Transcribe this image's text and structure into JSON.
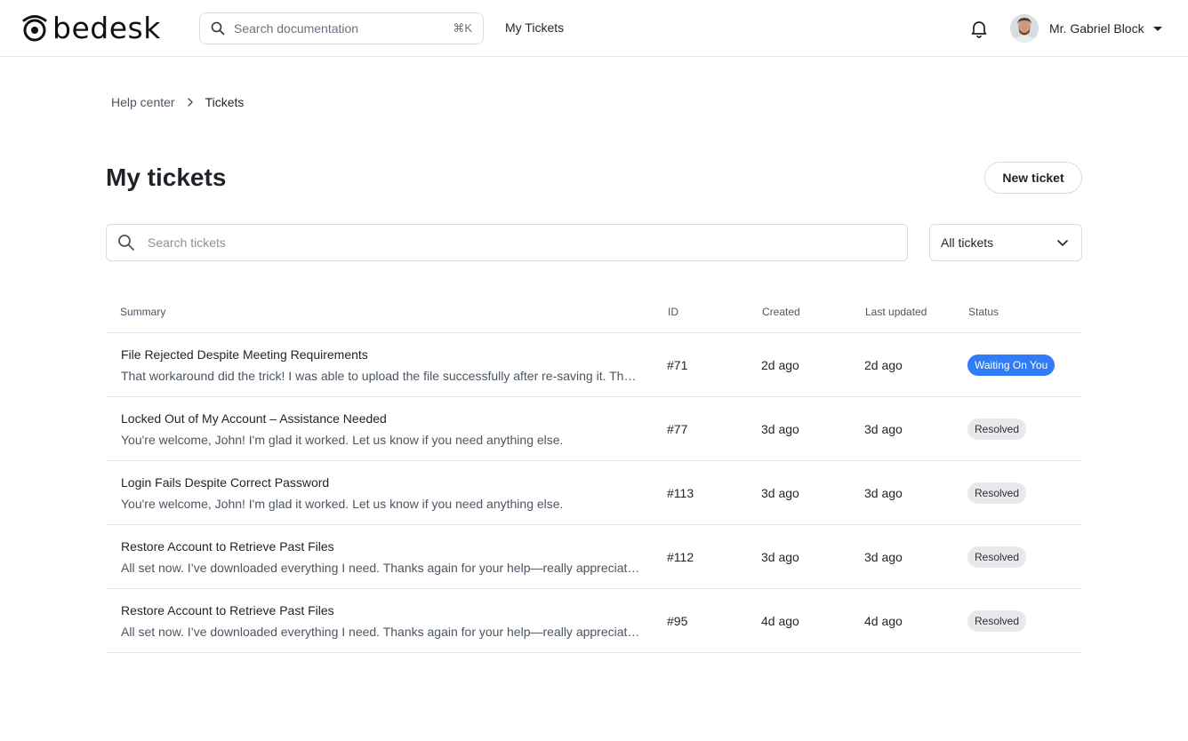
{
  "header": {
    "logo_text": "bedesk",
    "search_placeholder": "Search documentation",
    "search_shortcut": "⌘K",
    "nav_link": "My Tickets",
    "user_name": "Mr. Gabriel Block"
  },
  "breadcrumb": {
    "home": "Help center",
    "current": "Tickets"
  },
  "page": {
    "title": "My tickets",
    "new_ticket_label": "New ticket",
    "search_placeholder": "Search tickets",
    "filter_value": "All tickets"
  },
  "table": {
    "columns": {
      "summary": "Summary",
      "id": "ID",
      "created": "Created",
      "updated": "Last updated",
      "status": "Status"
    },
    "rows": [
      {
        "title": "File Rejected Despite Meeting Requirements",
        "body": "That workaround did the trick! I was able to upload the file successfully after re-saving it. Thanks again!",
        "id": "#71",
        "created": "2d ago",
        "updated": "2d ago",
        "status": "Waiting On You"
      },
      {
        "title": "Locked Out of My Account – Assistance Needed",
        "body": "You're welcome, John! I'm glad it worked. Let us know if you need anything else.",
        "id": "#77",
        "created": "3d ago",
        "updated": "3d ago",
        "status": "Resolved"
      },
      {
        "title": "Login Fails Despite Correct Password",
        "body": "You're welcome, John! I'm glad it worked. Let us know if you need anything else.",
        "id": "#113",
        "created": "3d ago",
        "updated": "3d ago",
        "status": "Resolved"
      },
      {
        "title": "Restore Account to Retrieve Past Files",
        "body": "All set now. I’ve downloaded everything I need. Thanks again for your help—really appreciate it!",
        "id": "#112",
        "created": "3d ago",
        "updated": "3d ago",
        "status": "Resolved"
      },
      {
        "title": "Restore Account to Retrieve Past Files",
        "body": "All set now. I’ve downloaded everything I need. Thanks again for your help—really appreciate it!",
        "id": "#95",
        "created": "4d ago",
        "updated": "4d ago",
        "status": "Resolved"
      }
    ]
  },
  "colors": {
    "accent": "#2f7cf6",
    "resolved_badge": "#e8e9eb",
    "border": "#e5e7eb"
  }
}
